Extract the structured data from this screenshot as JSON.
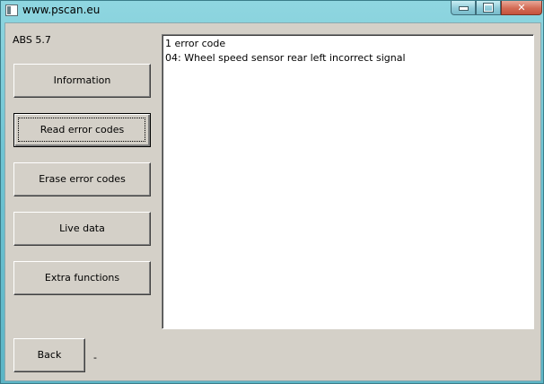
{
  "window": {
    "title": "www.pscan.eu",
    "icon": "application-icon",
    "controls": {
      "minimize_icon": "minimize-icon",
      "maximize_icon": "maximize-icon",
      "close_glyph": "✕"
    }
  },
  "module": {
    "label": "ABS 5.7"
  },
  "menu": {
    "information": "Information",
    "read_error_codes": "Read error codes",
    "erase_error_codes": "Erase error codes",
    "live_data": "Live data",
    "extra_functions": "Extra functions"
  },
  "output": {
    "lines": [
      "1 error code",
      "04: Wheel speed sensor rear left incorrect signal"
    ]
  },
  "footer": {
    "back_label": "Back",
    "status_text": "-"
  }
}
